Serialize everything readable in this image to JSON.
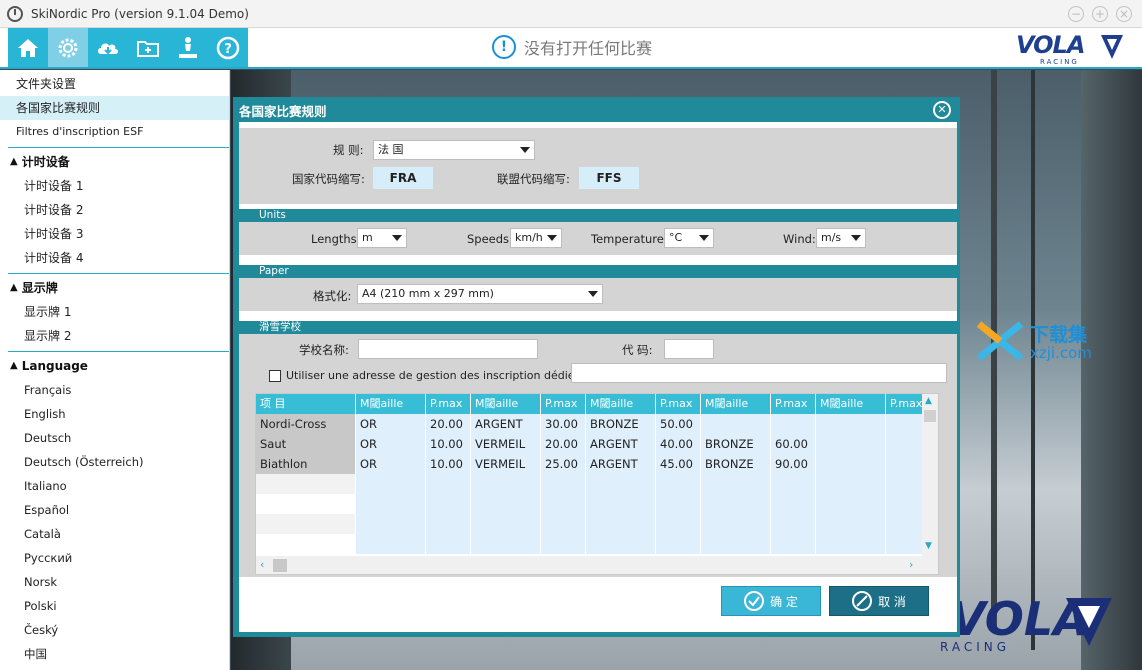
{
  "window": {
    "title": "SkiNordic Pro (version 9.1.04 Demo)",
    "controls": [
      "−",
      "+",
      "×"
    ]
  },
  "toolbar": {
    "buttons": [
      "home-icon",
      "gear-icon",
      "cloud-download-icon",
      "folder-add-icon",
      "podium-icon",
      "help-icon"
    ],
    "active": "gear-icon",
    "status_text": "没有打开任何比赛",
    "status_icon": "info-icon",
    "logo_text": "VOLA",
    "logo_sub": "RACING"
  },
  "sidebar": {
    "top_items": [
      "文件夹设置",
      "各国家比赛规则",
      "Filtres d'inscription ESF"
    ],
    "selected": "各国家比赛规则",
    "timing_header": "计时设备",
    "timing_items": [
      "计时设备 1",
      "计时设备 2",
      "计时设备 3",
      "计时设备 4"
    ],
    "display_header": "显示牌",
    "display_items": [
      "显示牌 1",
      "显示牌 2"
    ],
    "language_header": "Language",
    "languages": [
      "Français",
      "English",
      "Deutsch",
      "Deutsch (Österreich)",
      "Italiano",
      "Español",
      "Català",
      "Русский",
      "Norsk",
      "Polski",
      "Český",
      "中国"
    ]
  },
  "dialog": {
    "title": "各国家比赛规则",
    "rule_label": "规 则:",
    "rule_value": "法 国",
    "country_code_label": "国家代码缩写:",
    "country_code": "FRA",
    "federation_code_label": "联盟代码缩写:",
    "federation_code": "FFS",
    "units_section": "Units",
    "lengths_label": "Lengths:",
    "lengths_value": "m",
    "speeds_label": "Speeds:",
    "speeds_value": "km/h",
    "temperatures_label": "Temperatures:",
    "temperatures_value": "°C",
    "wind_label": "Wind:",
    "wind_value": "m/s",
    "paper_section": "Paper",
    "format_label": "格式化:",
    "format_value": "A4 (210 mm x 297 mm)",
    "school_section": "滑雪学校",
    "school_name_label": "学校名称:",
    "school_code_label": "代 码:",
    "esf_checkbox_label": "Utiliser une adresse de gestion des inscription dédié",
    "table": {
      "headers": [
        "项 目",
        "M閾aille",
        "P.max",
        "M閾aille",
        "P.max",
        "M閾aille",
        "P.max",
        "M閾aille",
        "P.max",
        "M閾aille",
        "P.max"
      ],
      "rows": [
        [
          "Nordi-Cross",
          "OR",
          "20.00",
          "ARGENT",
          "30.00",
          "BRONZE",
          "50.00",
          "",
          "",
          "",
          ""
        ],
        [
          "Saut",
          "OR",
          "10.00",
          "VERMEIL",
          "20.00",
          "ARGENT",
          "40.00",
          "BRONZE",
          "60.00",
          "",
          ""
        ],
        [
          "Biathlon",
          "OR",
          "10.00",
          "VERMEIL",
          "25.00",
          "ARGENT",
          "45.00",
          "BRONZE",
          "90.00",
          "",
          ""
        ]
      ],
      "empty_rows": 4
    },
    "ok_label": "确 定",
    "cancel_label": "取 消"
  },
  "watermark": {
    "line1": "下载集",
    "line2": "xzji.com"
  },
  "background_logo": {
    "text": "VOLA",
    "sub": "RACING"
  }
}
